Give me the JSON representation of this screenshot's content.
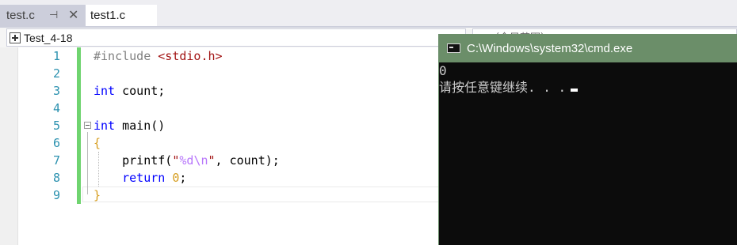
{
  "tabs": [
    {
      "label": "test.c",
      "pin_icon": "pin-icon",
      "close_icon": "close-icon"
    },
    {
      "label": "test1.c"
    }
  ],
  "navbar": {
    "scope": "Test_4-18",
    "scope_right": "（全局范围）"
  },
  "editor": {
    "line_numbers": [
      "1",
      "2",
      "3",
      "4",
      "5",
      "6",
      "7",
      "8",
      "9"
    ],
    "lines": [
      {
        "pp": "#include ",
        "inc": "<stdio.h>"
      },
      {},
      {
        "kw": "int",
        "rest": " count;"
      },
      {},
      {
        "kw": "int",
        "rest": " main()"
      },
      {
        "brace": "{"
      },
      {
        "a": "    printf(",
        "q1": "\"",
        "fmt": "%d",
        "esc": "\\n",
        "q2": "\"",
        "b": ", count);"
      },
      {
        "kw_indent": "    ",
        "kw": "return",
        "rest_pre": " ",
        "num": "0",
        "rest": ";"
      },
      {
        "brace": "}"
      }
    ]
  },
  "console": {
    "title": "C:\\Windows\\system32\\cmd.exe",
    "output": [
      "0",
      "请按任意键继续. . ."
    ]
  },
  "colors": {
    "console_titlebar": "#6b8e69",
    "change_bar": "#6fd46f",
    "keyword": "#0000ff",
    "string": "#a31515",
    "line_number": "#2b91af"
  }
}
